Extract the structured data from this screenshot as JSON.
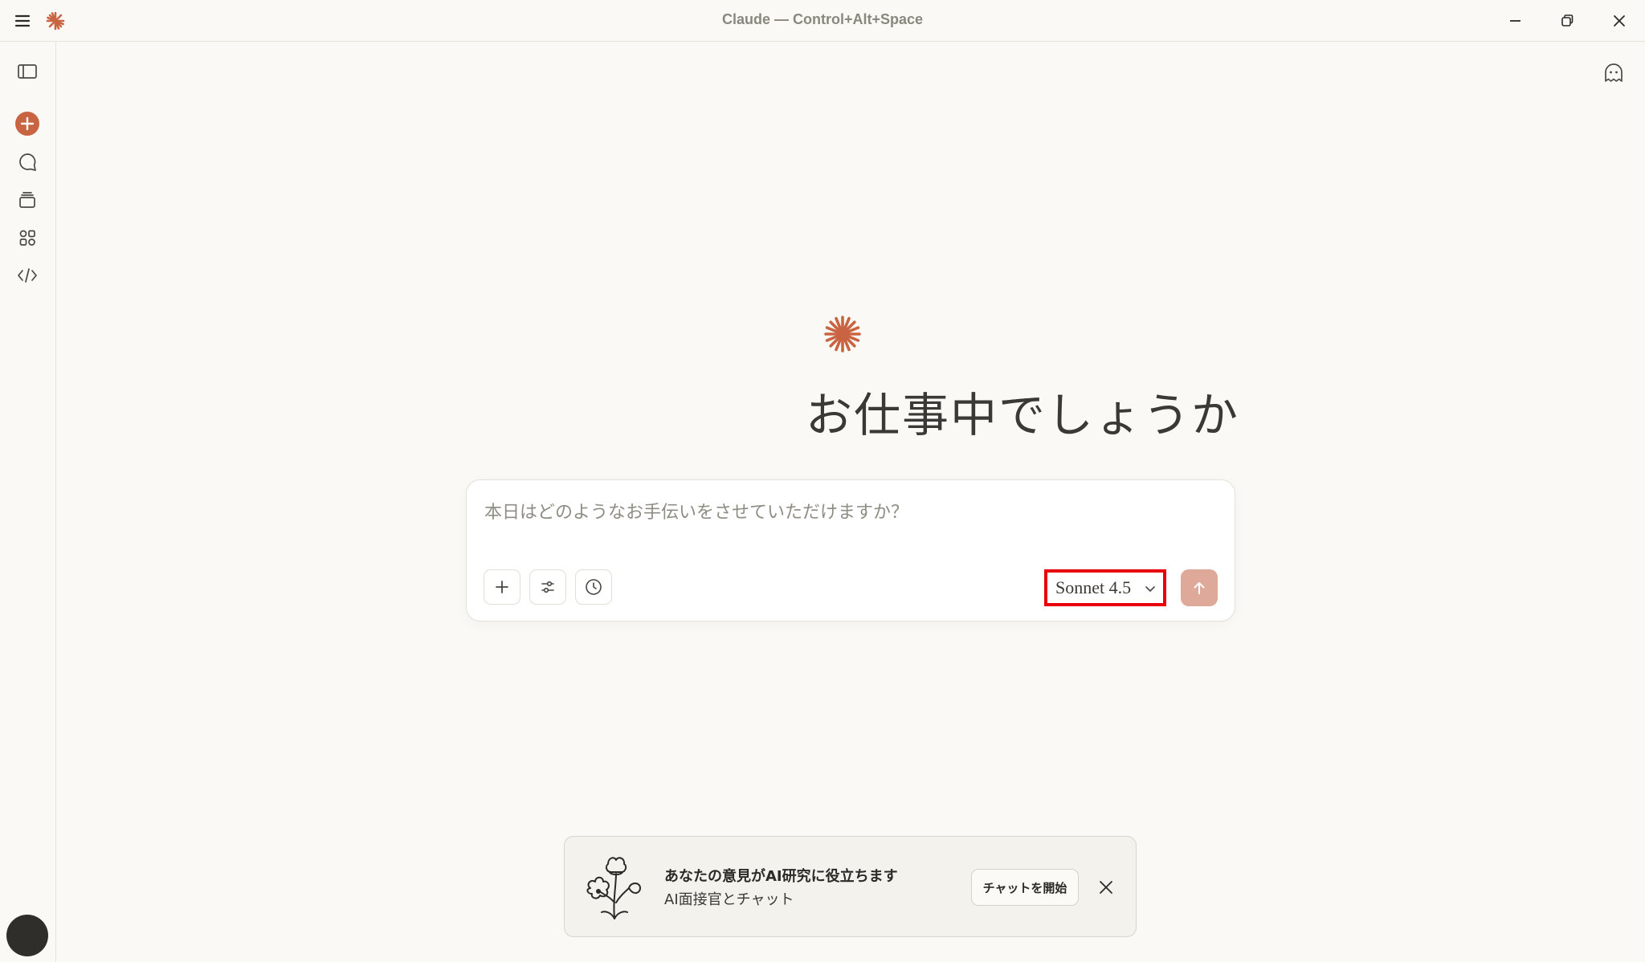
{
  "window": {
    "title": "Claude — Control+Alt+Space",
    "controls": [
      "minimize-icon",
      "restore-icon",
      "close-icon"
    ]
  },
  "sidebar": {
    "items": [
      {
        "name": "sidebar-toggle",
        "icon": "sidebar-panel-icon"
      },
      {
        "name": "new-chat",
        "icon": "plus-circle-icon"
      },
      {
        "name": "chats",
        "icon": "chat-bubble-icon"
      },
      {
        "name": "projects",
        "icon": "stack-icon"
      },
      {
        "name": "artifacts",
        "icon": "shapes-icon"
      },
      {
        "name": "code",
        "icon": "code-brackets-icon"
      }
    ],
    "avatar": "avatar"
  },
  "hero": {
    "logo": "claude-spark-icon",
    "greeting": "お仕事中でしょうか"
  },
  "composer": {
    "placeholder": "本日はどのようなお手伝いをさせていただけますか？",
    "value": "",
    "model": "Sonnet 4.5",
    "buttons": [
      "plus-icon",
      "sliders-icon",
      "clock-icon",
      "arrow-up-icon"
    ]
  },
  "banner": {
    "title": "あなたの意見がAI研究に役立ちます",
    "subtitle": "AI面接官とチャット",
    "cta": "チャットを開始",
    "art": "flower-illustration-icon"
  },
  "colors": {
    "accent": "#c96442",
    "background": "#faf9f5",
    "send_button": "#dfa99a",
    "highlight_border": "#e8000b"
  }
}
